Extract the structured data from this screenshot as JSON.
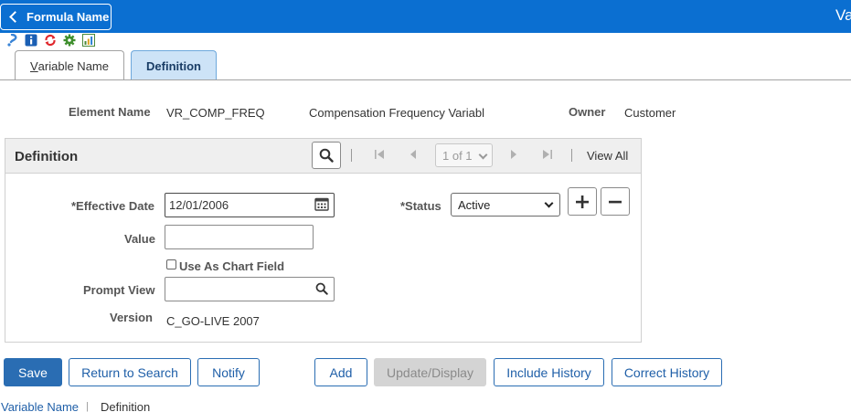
{
  "header": {
    "back_label": "Formula Name",
    "title": "Va",
    "toolbar_icons": [
      "help-icon",
      "info-icon",
      "refresh-icon",
      "settings-icon",
      "chart-icon"
    ]
  },
  "tabs": [
    {
      "label_underlined": "V",
      "label_rest": "ariable Name"
    },
    {
      "label": "Definition"
    }
  ],
  "element": {
    "name_label": "Element Name",
    "name_value": "VR_COMP_FREQ",
    "description": "Compensation Frequency Variabl",
    "owner_label": "Owner",
    "owner_value": "Customer"
  },
  "definition_panel": {
    "title": "Definition",
    "pager_value": "1 of 1",
    "view_all": "View All",
    "effective_date_label": "*Effective Date",
    "effective_date_value": "12/01/2006",
    "status_label": "*Status",
    "status_value": "Active",
    "value_label": "Value",
    "value_value": "",
    "chart_field_label": "Use As Chart Field",
    "prompt_view_label": "Prompt View",
    "prompt_view_value": "",
    "version_label": "Version",
    "version_value": "C_GO-LIVE 2007"
  },
  "buttons": {
    "save": "Save",
    "return_to_search": "Return to Search",
    "notify": "Notify",
    "add": "Add",
    "update_display": "Update/Display",
    "include_history": "Include History",
    "correct_history": "Correct History"
  },
  "footer": {
    "link_variable_name": "Variable Name",
    "separator": "|",
    "current": "Definition"
  },
  "colors": {
    "header_blue": "#0b6fd1",
    "primary_button": "#2a6db3",
    "active_tab": "#cde3f7"
  }
}
